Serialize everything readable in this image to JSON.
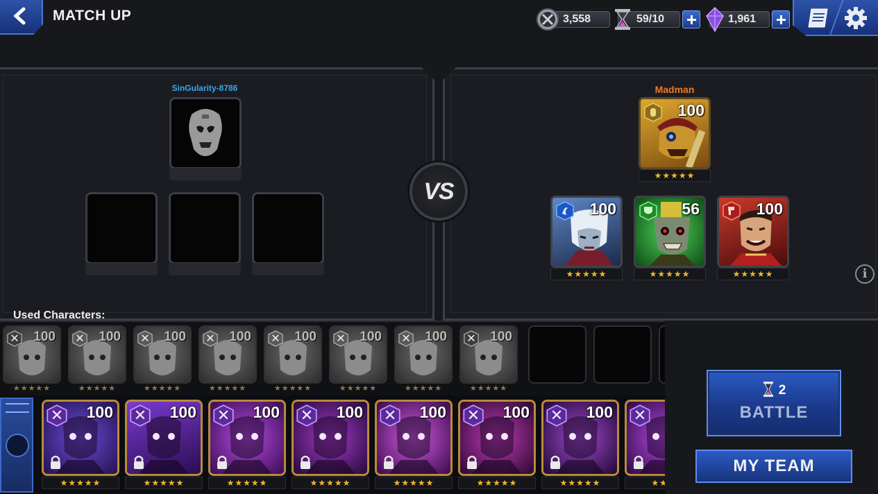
{
  "header": {
    "title": "MATCH UP",
    "currency": [
      {
        "icon": "crossed-swords-coin-icon",
        "value": "3,558",
        "has_plus": false
      },
      {
        "icon": "hourglass-icon",
        "value": "59/10",
        "has_plus": true
      },
      {
        "icon": "crystal-icon",
        "value": "1,961",
        "has_plus": true
      }
    ]
  },
  "left_team": {
    "player_name": "SinGularity-8786"
  },
  "vs_label": "VS",
  "right_team": {
    "player_name": "Madman",
    "leader": {
      "level": "100",
      "stars": "★★★★★",
      "class": "gold"
    },
    "members": [
      {
        "level": "100",
        "stars": "★★★★★",
        "class": "blue"
      },
      {
        "level": "56",
        "stars": "★★★★★",
        "class": "green"
      },
      {
        "level": "100",
        "stars": "★★★★★",
        "class": "red"
      }
    ]
  },
  "used_characters": {
    "label": "Used Characters:",
    "cards": [
      {
        "level": "100",
        "stars": "★★★★★",
        "class": "purple"
      },
      {
        "level": "100",
        "stars": "★★★★★",
        "class": "gold"
      },
      {
        "level": "100",
        "stars": "★★★★★",
        "class": "gold"
      },
      {
        "level": "100",
        "stars": "★★★★★",
        "class": "gold"
      },
      {
        "level": "100",
        "stars": "★★★★★",
        "class": "gold"
      },
      {
        "level": "100",
        "stars": "★★★★★",
        "class": "gold"
      },
      {
        "level": "100",
        "stars": "★★★★★",
        "class": "gold"
      },
      {
        "level": "100",
        "stars": "★★★★★",
        "class": "purple"
      }
    ]
  },
  "roster": [
    {
      "level": "100",
      "stars": "★★★★★",
      "class": "purple",
      "locked": true
    },
    {
      "level": "100",
      "stars": "★★★★★",
      "class": "purple",
      "locked": true
    },
    {
      "level": "100",
      "stars": "★★★★★",
      "class": "purple",
      "locked": true
    },
    {
      "level": "100",
      "stars": "★★★★★",
      "class": "purple",
      "locked": true
    },
    {
      "level": "100",
      "stars": "★★★★★",
      "class": "purple",
      "locked": true
    },
    {
      "level": "100",
      "stars": "★★★★★",
      "class": "purple",
      "locked": true
    },
    {
      "level": "100",
      "stars": "★★★★★",
      "class": "purple",
      "locked": true
    },
    {
      "level": "",
      "stars": "★★★",
      "class": "purple",
      "locked": true
    }
  ],
  "battle_button": {
    "cost": "2",
    "label": "BATTLE"
  },
  "my_team_button": {
    "label": "MY TEAM"
  },
  "colors": {
    "accent_blue": "#2b5ac4",
    "star_gold": "#f2b62c",
    "left_name": "#3fa4e8",
    "right_name": "#f07826"
  }
}
